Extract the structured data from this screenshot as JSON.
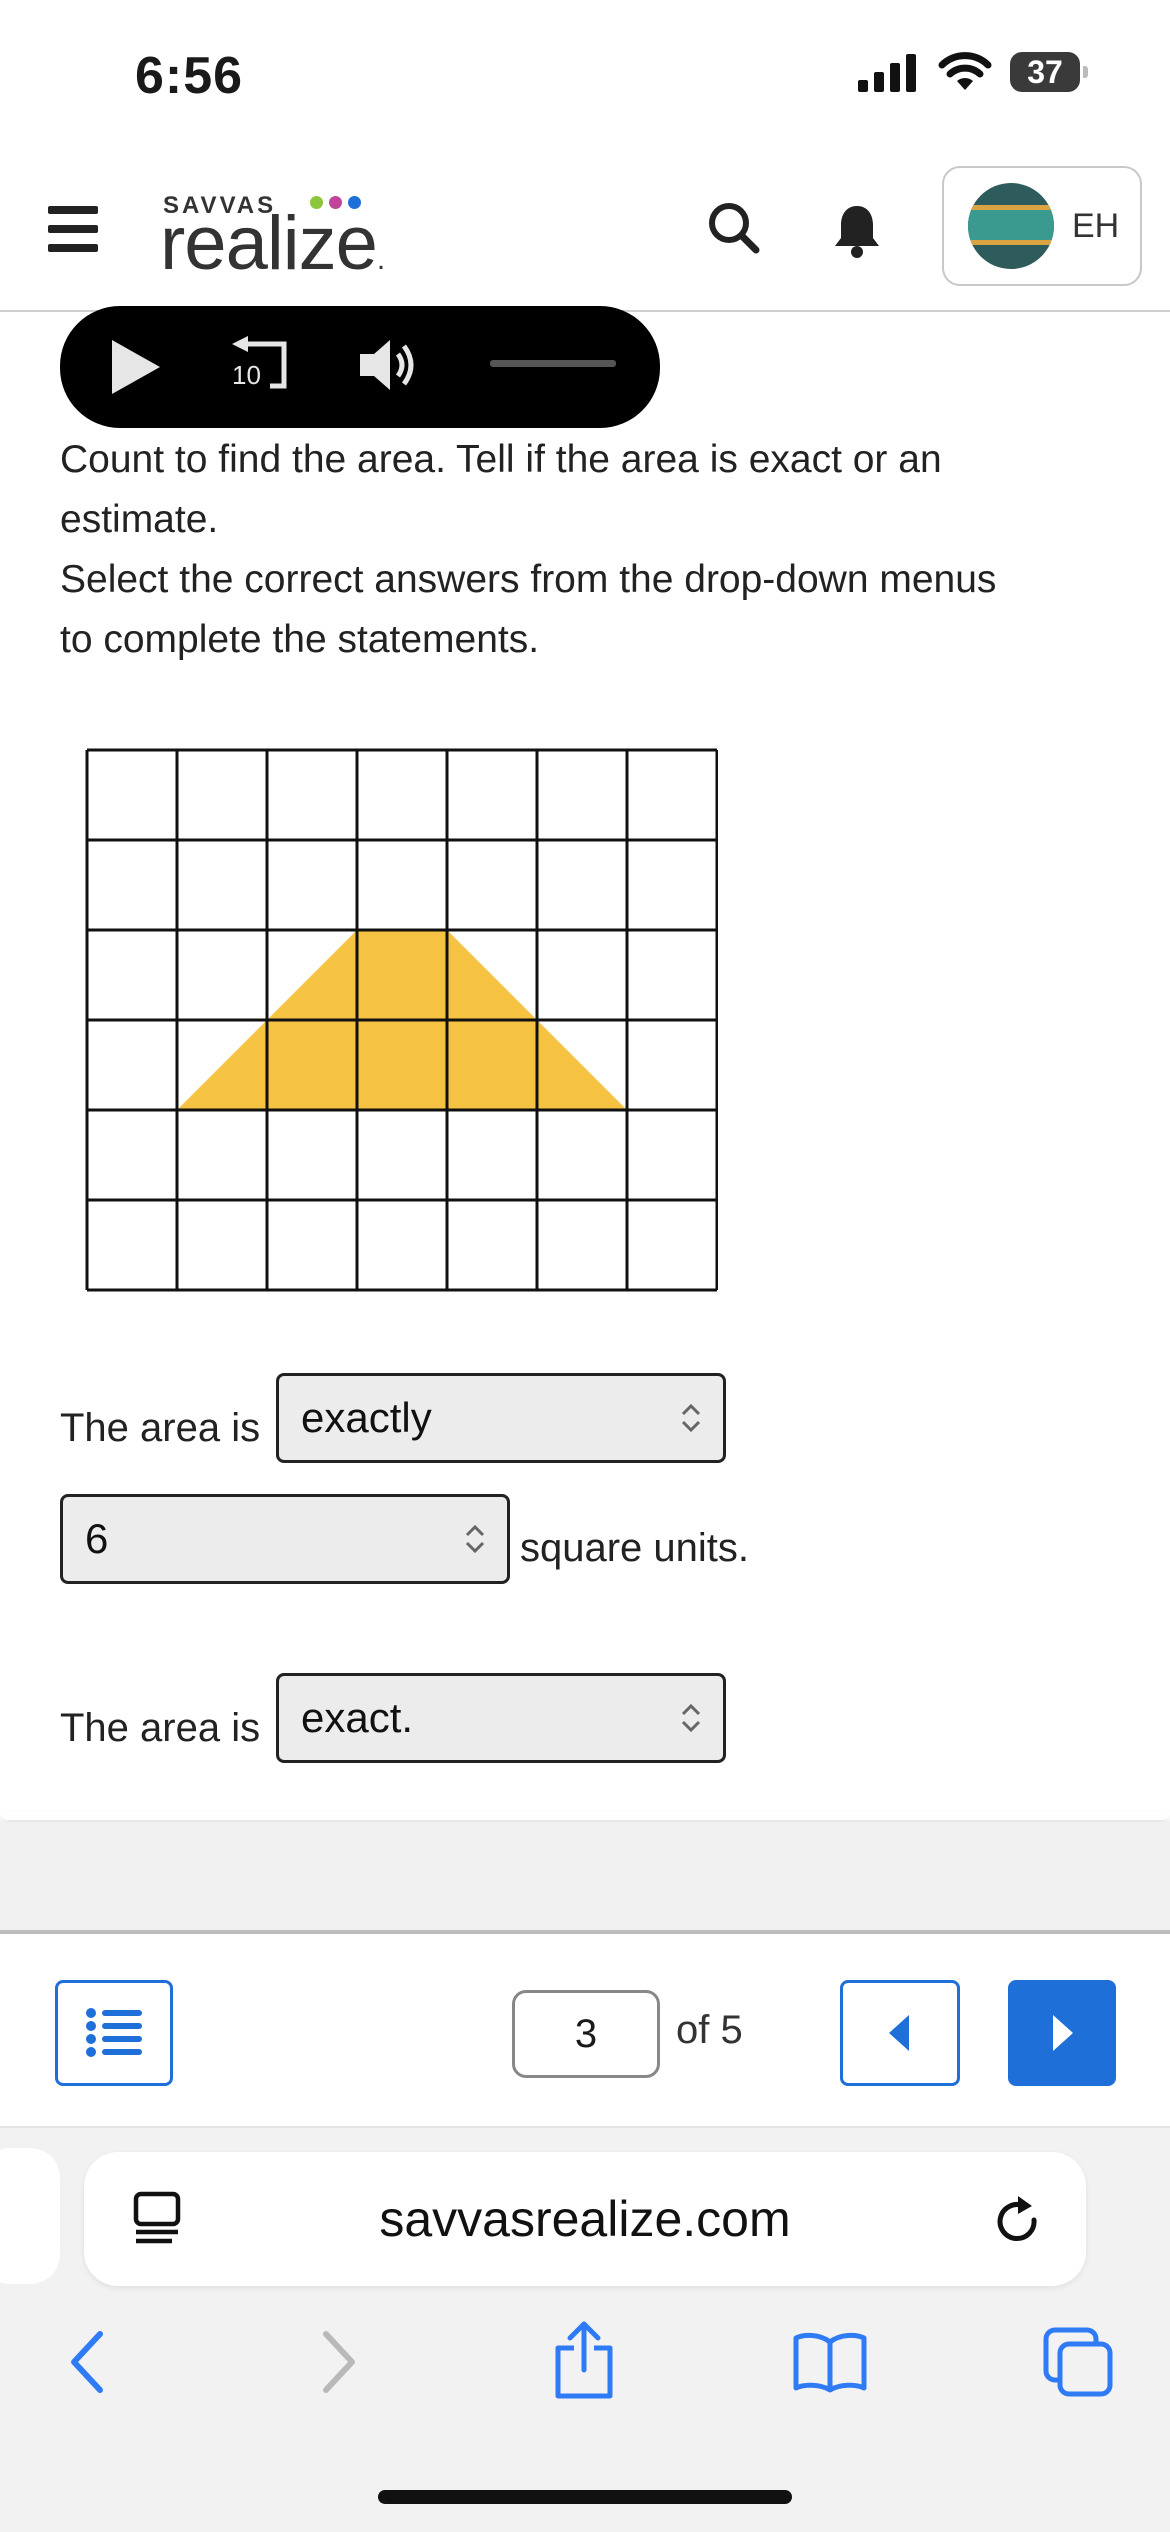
{
  "status_bar": {
    "time": "6:56",
    "battery": "37"
  },
  "header": {
    "brand_top": "SAVVAS",
    "brand_name": "realize",
    "brand_mark": ".",
    "avatar_initials": "EH",
    "icons": [
      "menu-icon",
      "search-icon",
      "bell-icon"
    ]
  },
  "audio_player": {
    "replay_seconds": "10"
  },
  "instructions": {
    "line1": "Count to find the area. Tell if the area is exact or an",
    "line2": "estimate.",
    "line3": "Select the correct answers from the drop-down menus",
    "line4": "to complete the statements."
  },
  "figure": {
    "grid_columns": 7,
    "grid_rows": 6,
    "shape": "trapezoid",
    "fill_color": "#F5C242"
  },
  "statements": {
    "s1_prefix": "The area is",
    "s1_select_value": "exactly",
    "s2_select_value": "6",
    "s2_suffix": "square units.",
    "s3_prefix": "The area is",
    "s3_select_value": "exact."
  },
  "pager": {
    "current_page": "3",
    "of_label": "of 5"
  },
  "browser": {
    "url": "savvasrealize.com"
  },
  "colors": {
    "accent": "#1F6FD8"
  }
}
